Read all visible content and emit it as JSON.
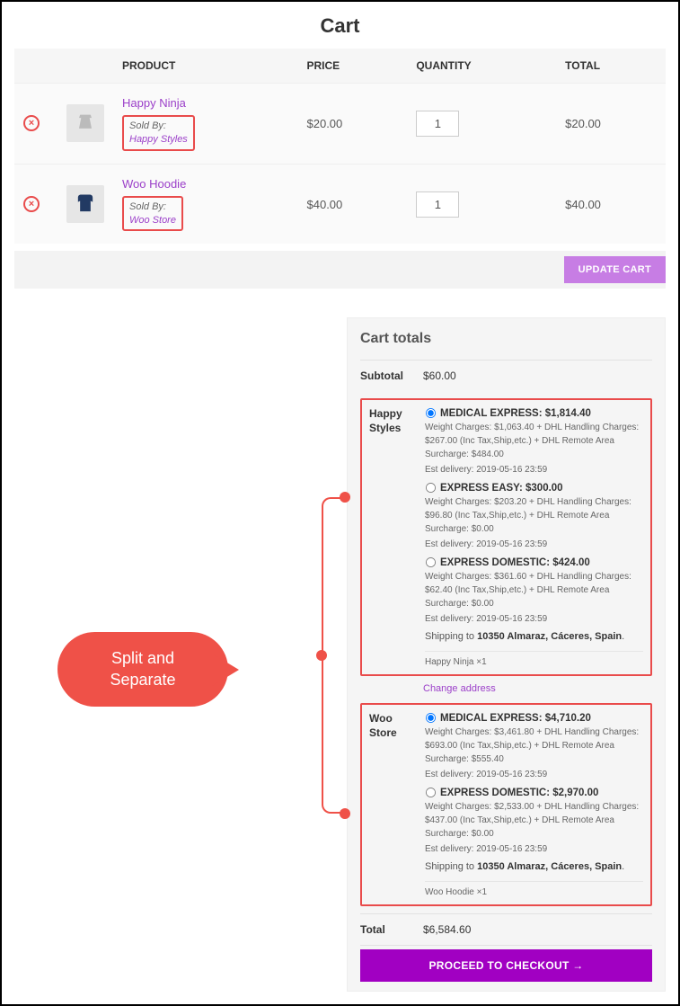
{
  "title": "Cart",
  "headers": {
    "product": "PRODUCT",
    "price": "PRICE",
    "qty": "QUANTITY",
    "total": "TOTAL"
  },
  "items": [
    {
      "name": "Happy Ninja",
      "soldby_label": "Sold By:",
      "vendor": "Happy Styles",
      "price": "$20.00",
      "qty": "1",
      "total": "$20.00"
    },
    {
      "name": "Woo Hoodie",
      "soldby_label": "Sold By:",
      "vendor": "Woo Store",
      "price": "$40.00",
      "qty": "1",
      "total": "$40.00"
    }
  ],
  "buttons": {
    "update": "UPDATE CART",
    "checkout": "PROCEED TO CHECKOUT  →"
  },
  "totals": {
    "heading": "Cart totals",
    "subtotal_label": "Subtotal",
    "subtotal": "$60.00",
    "total_label": "Total",
    "total": "$6,584.60",
    "change_address": "Change address",
    "shipping_to_prefix": "Shipping to ",
    "shipping_to_addr": "10350 Almaraz, Cáceres, Spain",
    "groups": [
      {
        "vendor": "Happy Styles",
        "contents": "Happy Ninja ×1",
        "options": [
          {
            "label": "MEDICAL EXPRESS: $1,814.40",
            "checked": true,
            "detail": "Weight Charges: $1,063.40 + DHL Handling Charges: $267.00 (Inc Tax,Ship,etc.) + DHL Remote Area Surcharge: $484.00",
            "eta": "Est delivery: 2019-05-16 23:59"
          },
          {
            "label": "EXPRESS EASY: $300.00",
            "checked": false,
            "detail": "Weight Charges: $203.20 + DHL Handling Charges: $96.80 (Inc Tax,Ship,etc.) + DHL Remote Area Surcharge: $0.00",
            "eta": "Est delivery: 2019-05-16 23:59"
          },
          {
            "label": "EXPRESS DOMESTIC: $424.00",
            "checked": false,
            "detail": "Weight Charges: $361.60 + DHL Handling Charges: $62.40 (Inc Tax,Ship,etc.) + DHL Remote Area Surcharge: $0.00",
            "eta": "Est delivery: 2019-05-16 23:59"
          }
        ]
      },
      {
        "vendor": "Woo Store",
        "contents": "Woo Hoodie ×1",
        "options": [
          {
            "label": "MEDICAL EXPRESS: $4,710.20",
            "checked": true,
            "detail": "Weight Charges: $3,461.80 + DHL Handling Charges: $693.00 (Inc Tax,Ship,etc.) + DHL Remote Area Surcharge: $555.40",
            "eta": "Est delivery: 2019-05-16 23:59"
          },
          {
            "label": "EXPRESS DOMESTIC: $2,970.00",
            "checked": false,
            "detail": "Weight Charges: $2,533.00 + DHL Handling Charges: $437.00 (Inc Tax,Ship,etc.) + DHL Remote Area Surcharge: $0.00",
            "eta": "Est delivery: 2019-05-16 23:59"
          }
        ]
      }
    ]
  },
  "callout": {
    "line1": "Split and",
    "line2": "Separate"
  }
}
